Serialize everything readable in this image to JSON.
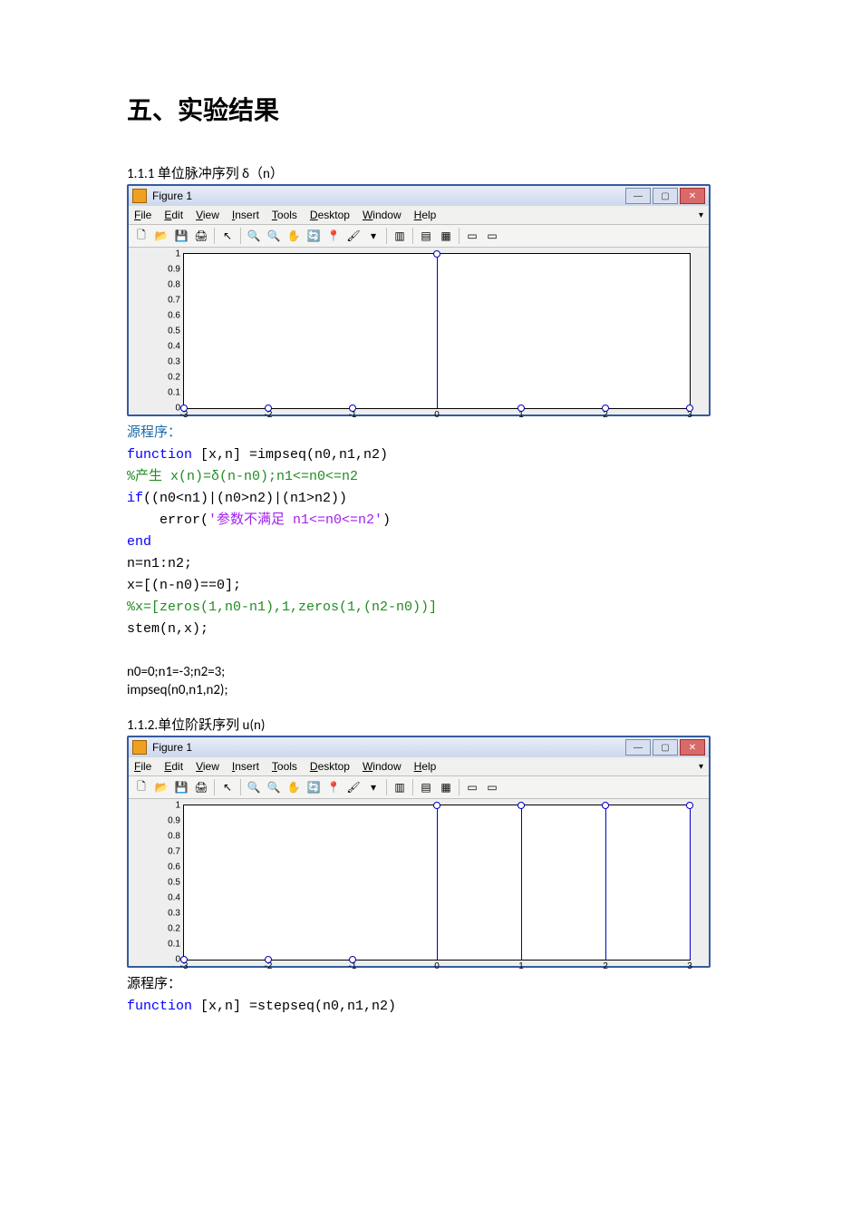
{
  "heading": "五、实验结果",
  "section1": {
    "caption": "1.1.1 单位脉冲序列 δ（n）",
    "figure": {
      "title": "Figure 1",
      "menus": [
        "File",
        "Edit",
        "View",
        "Insert",
        "Tools",
        "Desktop",
        "Window",
        "Help"
      ]
    },
    "src_label": "源程序：",
    "code_l1a": "function",
    "code_l1b": " [x,n] =impseq(n0,n1,n2)",
    "code_l2": "%产生 x(n)=δ(n-n0);n1<=n0<=n2",
    "code_l3a": "if",
    "code_l3b": "((n0<n1)|(n0>n2)|(n1>n2))",
    "code_l4a": "    error(",
    "code_l4b": "'参数不满足 n1<=n0<=n2'",
    "code_l4c": ")",
    "code_l5": "end",
    "code_l6": "n=n1:n2;",
    "code_l7": "x=[(n-n0)==0];",
    "code_l8": "%x=[zeros(1,n0-n1),1,zeros(1,(n2-n0))]",
    "code_l9": "stem(n,x);",
    "call1": "n0=0;n1=-3;n2=3;",
    "call2": "impseq(n0,n1,n2);"
  },
  "section2": {
    "caption": "1.1.2.单位阶跃序列 u(n)",
    "figure": {
      "title": "Figure 1",
      "menus": [
        "File",
        "Edit",
        "View",
        "Insert",
        "Tools",
        "Desktop",
        "Window",
        "Help"
      ]
    },
    "src_label": "源程序：",
    "code_l1a": "function",
    "code_l1b": " [x,n] =stepseq(n0,n1,n2)"
  },
  "chart_data": [
    {
      "type": "bar",
      "title": "单位脉冲序列 δ(n)",
      "x": [
        -3,
        -2,
        -1,
        0,
        1,
        2,
        3
      ],
      "values": [
        0,
        0,
        0,
        1,
        0,
        0,
        0
      ],
      "ylim": [
        0,
        1
      ],
      "yticks": [
        0,
        0.1,
        0.2,
        0.3,
        0.4,
        0.5,
        0.6,
        0.7,
        0.8,
        0.9,
        1
      ],
      "xlabel": "",
      "ylabel": ""
    },
    {
      "type": "bar",
      "title": "单位阶跃序列 u(n)",
      "x": [
        -3,
        -2,
        -1,
        0,
        1,
        2,
        3
      ],
      "values": [
        0,
        0,
        0,
        1,
        1,
        1,
        1
      ],
      "ylim": [
        0,
        1
      ],
      "yticks": [
        0,
        0.1,
        0.2,
        0.3,
        0.4,
        0.5,
        0.6,
        0.7,
        0.8,
        0.9,
        1
      ],
      "xlabel": "",
      "ylabel": ""
    }
  ],
  "ylabs": [
    "1",
    "0.9",
    "0.8",
    "0.7",
    "0.6",
    "0.5",
    "0.4",
    "0.3",
    "0.2",
    "0.1",
    "0"
  ],
  "xlabs": [
    "-3",
    "-2",
    "-1",
    "0",
    "1",
    "2",
    "3"
  ]
}
